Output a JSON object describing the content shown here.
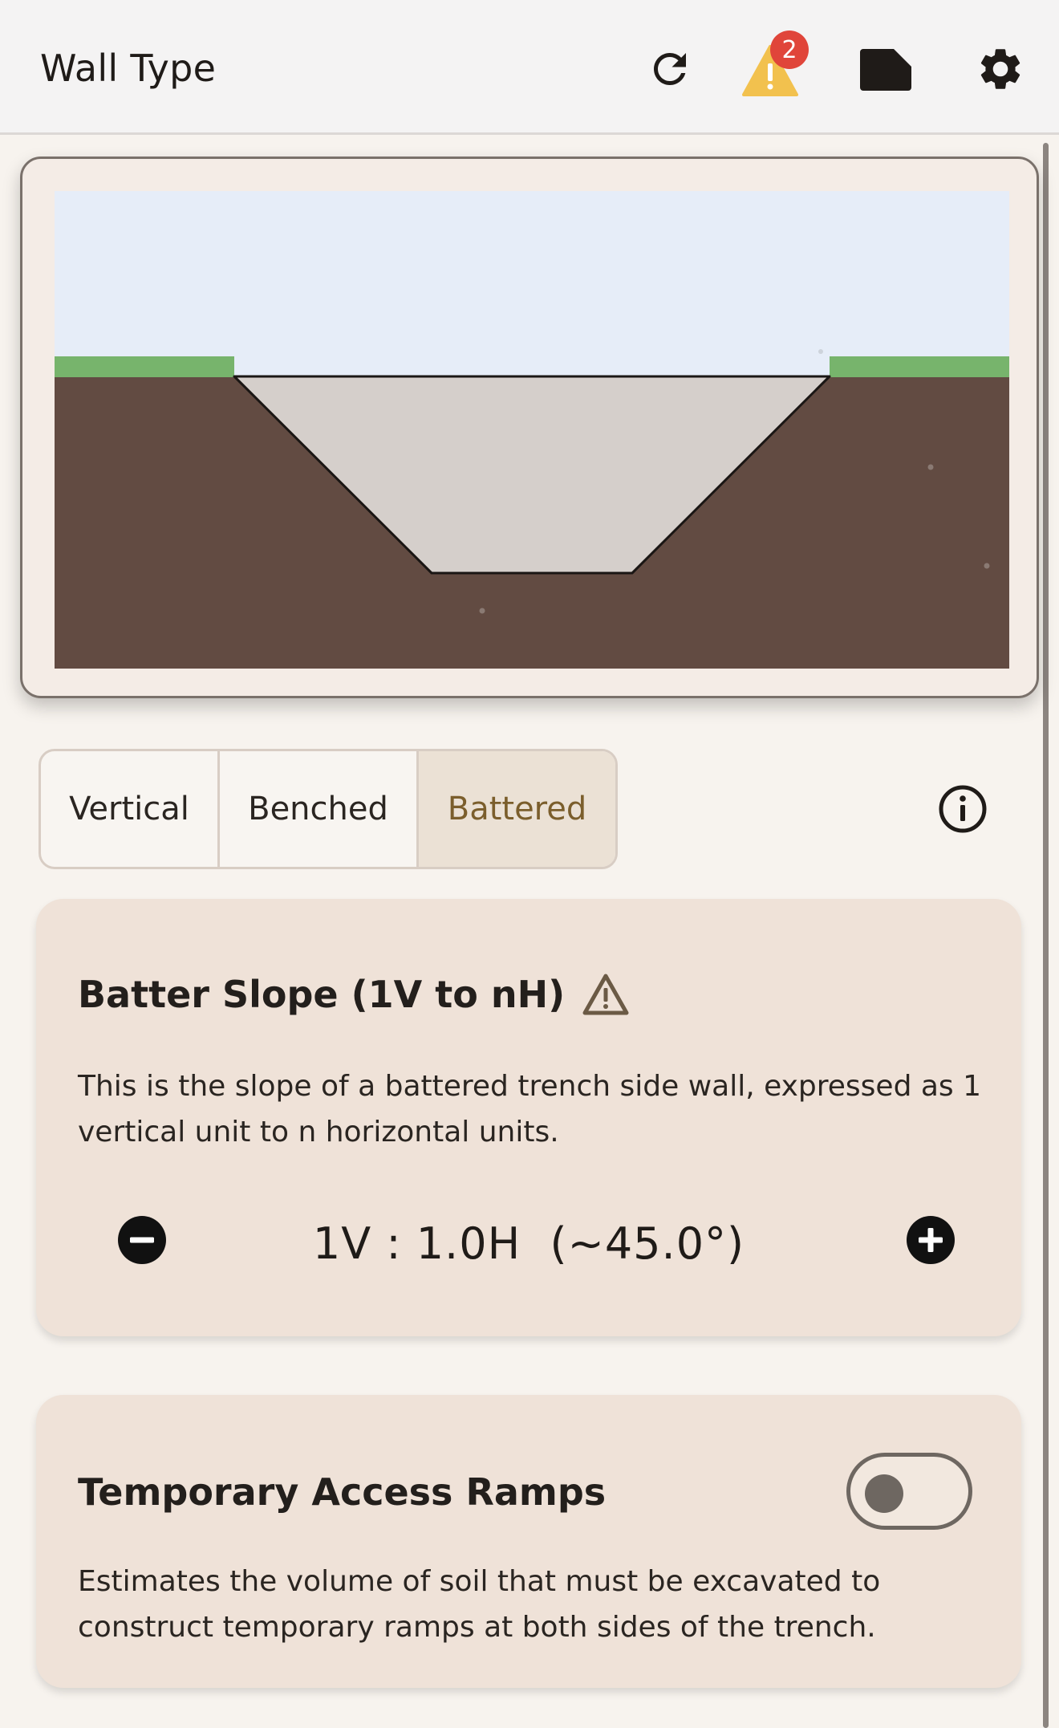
{
  "header": {
    "title": "Wall Type",
    "warning_count": "2",
    "icons": [
      "refresh-icon",
      "warning-icon",
      "label-tag-icon",
      "gear-icon"
    ],
    "colors": {
      "badge": "#e0453a",
      "warning": "#f2c14e"
    }
  },
  "illustration": {
    "description_colors": {
      "sky": "#e6edf8",
      "grass": "#77b46c",
      "soil": "#624b42",
      "trench": "#d5cfcb"
    }
  },
  "wall_type": {
    "options": [
      "Vertical",
      "Benched",
      "Battered"
    ],
    "selected": "Battered"
  },
  "batter_slope": {
    "title": "Batter Slope (1V to nH)",
    "description": "This is the slope of a battered trench side wall, expressed as 1 vertical unit to n horizontal units.",
    "value": "1V : 1.0H  (~45.0°)"
  },
  "access_ramps": {
    "title": "Temporary Access Ramps",
    "enabled": false,
    "description": "Estimates the volume of soil that must be excavated to construct temporary ramps at both sides of the trench."
  }
}
